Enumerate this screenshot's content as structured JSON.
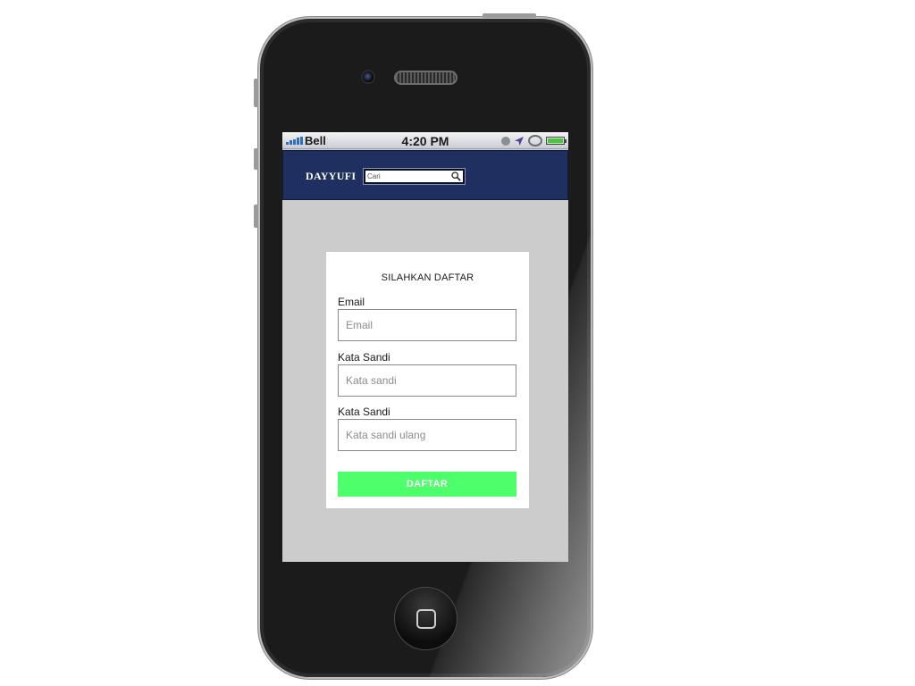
{
  "status_bar": {
    "carrier": "Bell",
    "time": "4:20 PM",
    "signal_bars": 5,
    "battery_level": 1.0,
    "icons": [
      "alarm-icon",
      "location-arrow-icon",
      "rotation-lock-icon",
      "battery-icon"
    ]
  },
  "header": {
    "brand": "DAYYUFI",
    "search_placeholder": "Cari",
    "search_icon": "search-icon"
  },
  "form": {
    "title": "SILAHKAN DAFTAR",
    "fields": [
      {
        "label": "Email",
        "placeholder": "Email"
      },
      {
        "label": "Kata Sandi",
        "placeholder": "Kata sandi"
      },
      {
        "label": "Kata Sandi",
        "placeholder": "Kata sandi ulang"
      }
    ],
    "submit_label": "DAFTAR"
  },
  "colors": {
    "header_bg": "#1f3060",
    "screen_bg": "#cccccc",
    "button_bg": "#4dff6a",
    "button_text": "#ffffff"
  }
}
